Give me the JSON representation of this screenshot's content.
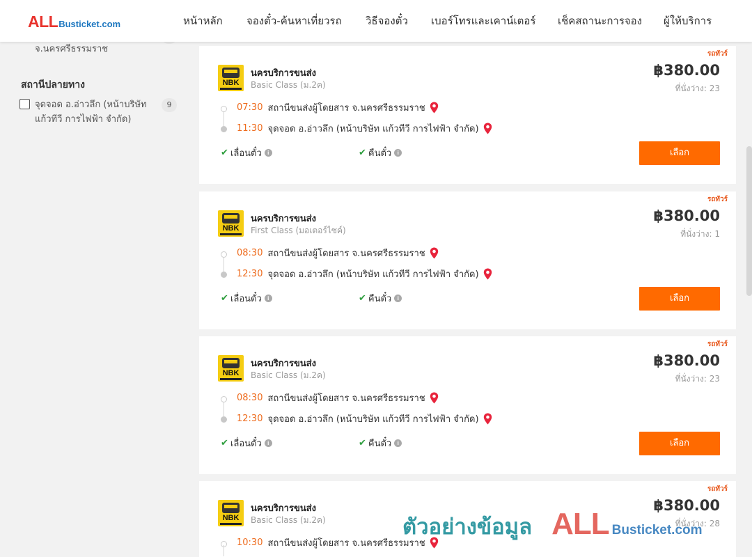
{
  "header": {
    "logo": {
      "all": "ALL",
      "rest": "Busticket.com"
    },
    "nav": [
      {
        "label": "หน้าหลัก"
      },
      {
        "label": "จองตั๋ว-ค้นหาเที่ยวรถ"
      },
      {
        "label": "วิธีจองตั๋ว"
      },
      {
        "label": "เบอร์โทรและเคาน์เตอร์"
      },
      {
        "label": "เช็คสถานะการจอง"
      },
      {
        "label": "ผู้ให้บริการ"
      }
    ]
  },
  "sidebar": {
    "origin_item": {
      "label": "สถานีขนส่งผู้โดยสาร จ.นครศรีธรรมราช",
      "count": "9",
      "checked": false
    },
    "destination_heading": "สถานีปลายทาง",
    "destination_item": {
      "label": "จุดจอด อ.อ่าวลึก (หน้าบริษัท แก้วทีวี การไฟฟ้า จำกัด)",
      "count": "9",
      "checked": false
    }
  },
  "trips": [
    {
      "bus_type": "รถทัวร์",
      "operator": "นครบริการขนส่ง",
      "operator_logo_text": "NBK",
      "class": "Basic Class (ม.2ค)",
      "price": "฿380.00",
      "seats": "ที่นั่งว่าง: 23",
      "depart_time": "07:30",
      "depart_station": "สถานีขนส่งผู้โดยสาร จ.นครศรีธรรมราช",
      "arrive_time": "11:30",
      "arrive_station": "จุดจอด อ.อ่าวลึก (หน้าบริษัท แก้วทีวี การไฟฟ้า จำกัด)",
      "feature1": "เลื่อนตั๋ว",
      "feature2": "คืนตั๋ว",
      "select_label": "เลือก"
    },
    {
      "bus_type": "รถทัวร์",
      "operator": "นครบริการขนส่ง",
      "operator_logo_text": "NBK",
      "class": "First Class (มอเตอร์ไซค์)",
      "price": "฿380.00",
      "seats": "ที่นั่งว่าง: 1",
      "depart_time": "08:30",
      "depart_station": "สถานีขนส่งผู้โดยสาร จ.นครศรีธรรมราช",
      "arrive_time": "12:30",
      "arrive_station": "จุดจอด อ.อ่าวลึก (หน้าบริษัท แก้วทีวี การไฟฟ้า จำกัด)",
      "feature1": "เลื่อนตั๋ว",
      "feature2": "คืนตั๋ว",
      "select_label": "เลือก"
    },
    {
      "bus_type": "รถทัวร์",
      "operator": "นครบริการขนส่ง",
      "operator_logo_text": "NBK",
      "class": "Basic Class (ม.2ค)",
      "price": "฿380.00",
      "seats": "ที่นั่งว่าง: 23",
      "depart_time": "08:30",
      "depart_station": "สถานีขนส่งผู้โดยสาร จ.นครศรีธรรมราช",
      "arrive_time": "12:30",
      "arrive_station": "จุดจอด อ.อ่าวลึก (หน้าบริษัท แก้วทีวี การไฟฟ้า จำกัด)",
      "feature1": "เลื่อนตั๋ว",
      "feature2": "คืนตั๋ว",
      "select_label": "เลือก"
    },
    {
      "bus_type": "รถทัวร์",
      "operator": "นครบริการขนส่ง",
      "operator_logo_text": "NBK",
      "class": "Basic Class (ม.2ค)",
      "price": "฿380.00",
      "seats": "ที่นั่งว่าง: 28",
      "depart_time": "10:30",
      "depart_station": "สถานีขนส่งผู้โดยสาร จ.นครศรีธรรมราช"
    }
  ],
  "watermark": {
    "thai": "ตัวอย่างข้อมูล",
    "all": "ALL",
    "rest": "Busticket.com"
  },
  "icons": {
    "check": "check-icon",
    "info": "info-icon",
    "pin": "map-pin-icon"
  },
  "colors": {
    "accent": "#ff6a00",
    "time": "#ee6c1e",
    "pin": "#e8243c",
    "check": "#2e9e3e"
  }
}
